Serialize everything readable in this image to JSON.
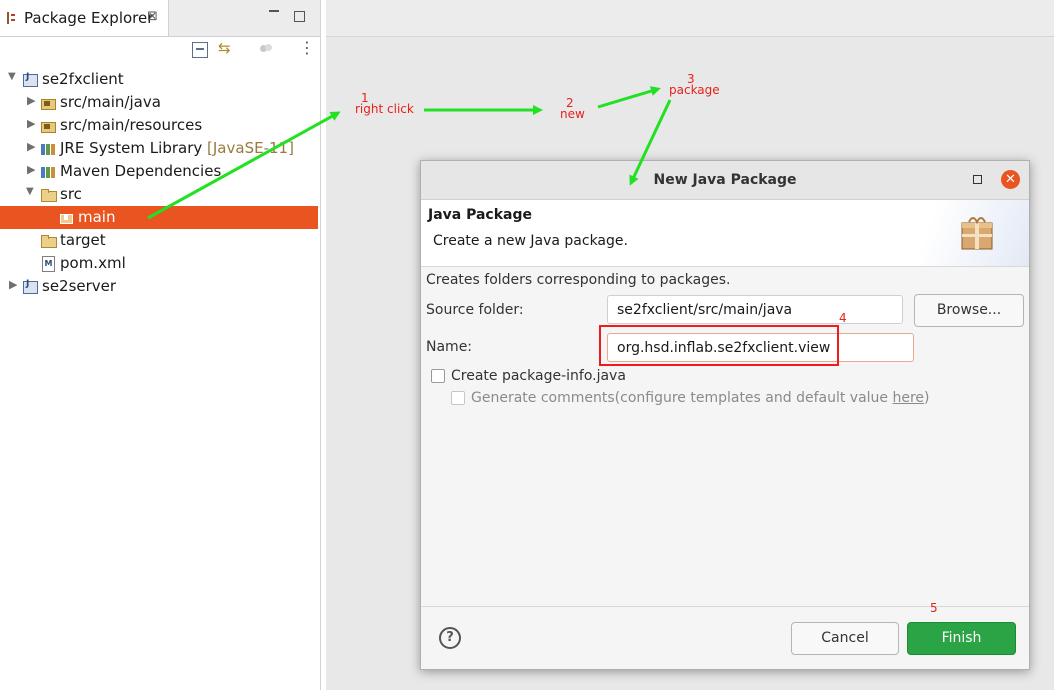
{
  "package_explorer": {
    "title": "Package Explorer",
    "close_glyph": "⊠",
    "tree": [
      {
        "label": "se2fxclient",
        "decoration": "",
        "icon": "java-project-icon",
        "expanded": true,
        "selected": false
      },
      {
        "label": "src/main/java",
        "decoration": "",
        "icon": "source-folder-icon",
        "expanded": false,
        "selected": false
      },
      {
        "label": "src/main/resources",
        "decoration": "",
        "icon": "source-folder-icon",
        "expanded": false,
        "selected": false
      },
      {
        "label": "JRE System Library",
        "decoration": "[JavaSE-11]",
        "icon": "library-icon",
        "expanded": false,
        "selected": false
      },
      {
        "label": "Maven Dependencies",
        "decoration": "",
        "icon": "library-icon",
        "expanded": false,
        "selected": false
      },
      {
        "label": "src",
        "decoration": "",
        "icon": "folder-icon",
        "expanded": true,
        "selected": false
      },
      {
        "label": "main",
        "decoration": "",
        "icon": "package-icon",
        "expanded": false,
        "selected": true
      },
      {
        "label": "target",
        "decoration": "",
        "icon": "folder-icon",
        "expanded": false,
        "selected": false
      },
      {
        "label": "pom.xml",
        "decoration": "",
        "icon": "maven-file-icon",
        "expanded": false,
        "selected": false
      },
      {
        "label": "se2server",
        "decoration": "",
        "icon": "java-project-icon",
        "expanded": false,
        "selected": false
      }
    ]
  },
  "dialog": {
    "title": "New Java Package",
    "header_title": "Java Package",
    "header_description": "Create a new Java package.",
    "description": "Creates folders corresponding to packages.",
    "source_folder_label": "Source folder:",
    "source_folder_value": "se2fxclient/src/main/java",
    "browse_label": "Browse...",
    "name_label": "Name:",
    "name_value": "org.hsd.inflab.se2fxclient.view",
    "create_package_info_label": "Create package-info.java",
    "create_package_info_checked": false,
    "generate_comments_label": "Generate comments",
    "generate_comments_paren": "(configure templates and default value ",
    "generate_comments_link": "here",
    "generate_comments_close": ")",
    "generate_comments_checked": false,
    "help_glyph": "?",
    "cancel_label": "Cancel",
    "finish_label": "Finish",
    "close_glyph": "✕"
  },
  "annotations": {
    "step1_number": "1",
    "step1_text": "right click",
    "step2_number": "2",
    "step2_text": "new",
    "step3_number": "3",
    "step3_text": "package",
    "step4_number": "4",
    "step5_number": "5"
  },
  "colors": {
    "selection": "#e95420",
    "finish_button": "#2aa444",
    "annotation_red": "#e8211c",
    "annotation_arrow_green": "#22e022"
  }
}
